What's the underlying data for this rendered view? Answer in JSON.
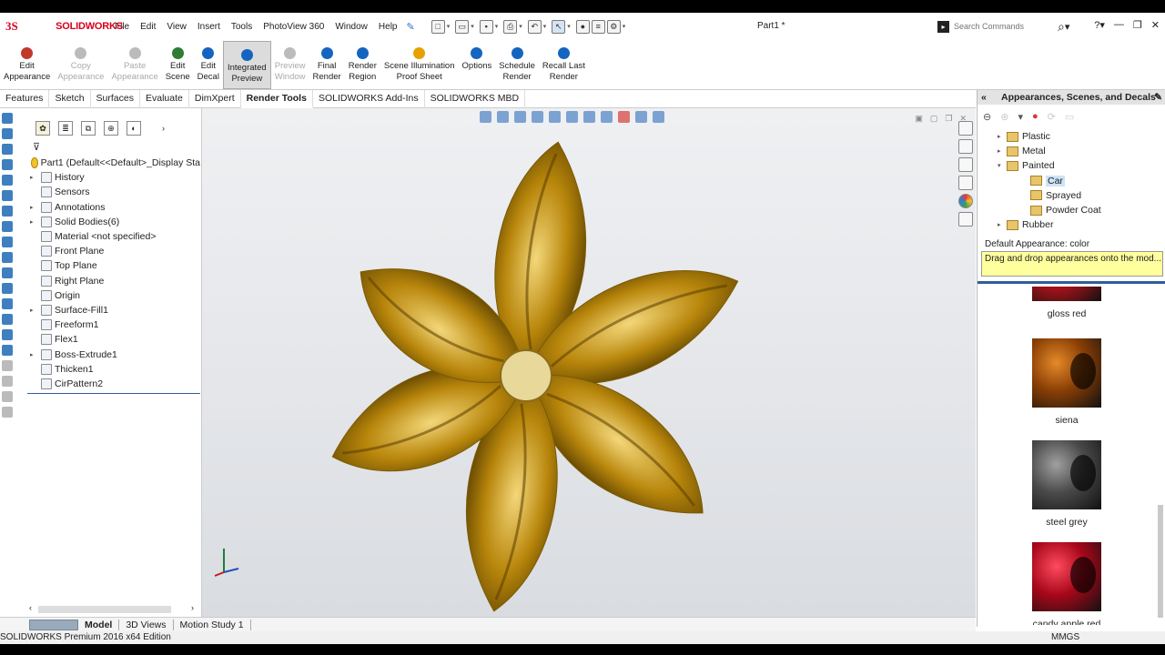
{
  "app": {
    "logo_ds": "3S",
    "logo_text": "SOLIDWORKS",
    "doc_title": "Part1 *",
    "search_placeholder": "Search Commands"
  },
  "menu": [
    "File",
    "Edit",
    "View",
    "Insert",
    "Tools",
    "PhotoView 360",
    "Window",
    "Help"
  ],
  "ribbon": [
    {
      "line1": "Edit",
      "line2": "Appearance",
      "state": "normal",
      "color": "#c0392b"
    },
    {
      "line1": "Copy",
      "line2": "Appearance",
      "state": "disabled",
      "color": "#bbbbbb"
    },
    {
      "line1": "Paste",
      "line2": "Appearance",
      "state": "disabled",
      "color": "#bbbbbb"
    },
    {
      "line1": "Edit",
      "line2": "Scene",
      "state": "normal",
      "color": "#2e7d32"
    },
    {
      "line1": "Edit",
      "line2": "Decal",
      "state": "normal",
      "color": "#1565c0"
    },
    {
      "line1": "Integrated",
      "line2": "Preview",
      "state": "active",
      "color": "#1565c0"
    },
    {
      "line1": "Preview",
      "line2": "Window",
      "state": "disabled",
      "color": "#bbbbbb"
    },
    {
      "line1": "Final",
      "line2": "Render",
      "state": "normal",
      "color": "#1565c0"
    },
    {
      "line1": "Render",
      "line2": "Region",
      "state": "normal",
      "color": "#1565c0"
    },
    {
      "line1": "Scene Illumination",
      "line2": "Proof Sheet",
      "state": "normal",
      "color": "#e6a100"
    },
    {
      "line1": "Options",
      "line2": "",
      "state": "normal",
      "color": "#1565c0"
    },
    {
      "line1": "Schedule",
      "line2": "Render",
      "state": "normal",
      "color": "#1565c0"
    },
    {
      "line1": "Recall Last",
      "line2": "Render",
      "state": "normal",
      "color": "#1565c0"
    }
  ],
  "command_tabs": [
    "Features",
    "Sketch",
    "Surfaces",
    "Evaluate",
    "DimXpert",
    "Render Tools",
    "SOLIDWORKS Add-Ins",
    "SOLIDWORKS MBD"
  ],
  "active_command_tab": "Render Tools",
  "feature_tree": {
    "root": "Part1  (Default<<Default>_Display Sta",
    "items": [
      {
        "label": "History",
        "expandable": true
      },
      {
        "label": "Sensors",
        "expandable": false
      },
      {
        "label": "Annotations",
        "expandable": true
      },
      {
        "label": "Solid Bodies(6)",
        "expandable": true
      },
      {
        "label": "Material <not specified>",
        "expandable": false
      },
      {
        "label": "Front Plane",
        "expandable": false
      },
      {
        "label": "Top Plane",
        "expandable": false
      },
      {
        "label": "Right Plane",
        "expandable": false
      },
      {
        "label": "Origin",
        "expandable": false
      },
      {
        "label": "Surface-Fill1",
        "expandable": true
      },
      {
        "label": "Freeform1",
        "expandable": false
      },
      {
        "label": "Flex1",
        "expandable": false
      },
      {
        "label": "Boss-Extrude1",
        "expandable": true
      },
      {
        "label": "Thicken1",
        "expandable": false
      },
      {
        "label": "CirPattern2",
        "expandable": false
      }
    ]
  },
  "bottom_tabs": [
    "Model",
    "3D Views",
    "Motion Study 1"
  ],
  "active_bottom_tab": "Model",
  "status": {
    "edition": "SOLIDWORKS Premium 2016 x64 Edition",
    "units": "MMGS"
  },
  "task_pane": {
    "title": "Appearances, Scenes, and Decals",
    "tree": [
      {
        "label": "Plastic",
        "level": 0,
        "expanded": false
      },
      {
        "label": "Metal",
        "level": 0,
        "expanded": false
      },
      {
        "label": "Painted",
        "level": 0,
        "expanded": true
      },
      {
        "label": "Car",
        "level": 1,
        "selected": true
      },
      {
        "label": "Sprayed",
        "level": 1
      },
      {
        "label": "Powder Coat",
        "level": 1
      },
      {
        "label": "Rubber",
        "level": 0,
        "expanded": false
      }
    ],
    "default_appearance": "Default Appearance: color",
    "tip": "Drag and drop appearances onto the mod...",
    "swatches": [
      {
        "name": "gloss red",
        "color": "#b3121b",
        "highlight": "#e8585e"
      },
      {
        "name": "siena",
        "color": "#8a3f05",
        "highlight": "#e58a2a"
      },
      {
        "name": "steel grey",
        "color": "#4a4a4a",
        "highlight": "#a0a0a0"
      },
      {
        "name": "candy apple red",
        "color": "#a8071a",
        "highlight": "#ff4b5e"
      }
    ]
  },
  "model": {
    "petal_color": "#b8860b",
    "petal_highlight": "#f3d77a",
    "center_color": "#e8d99a"
  }
}
